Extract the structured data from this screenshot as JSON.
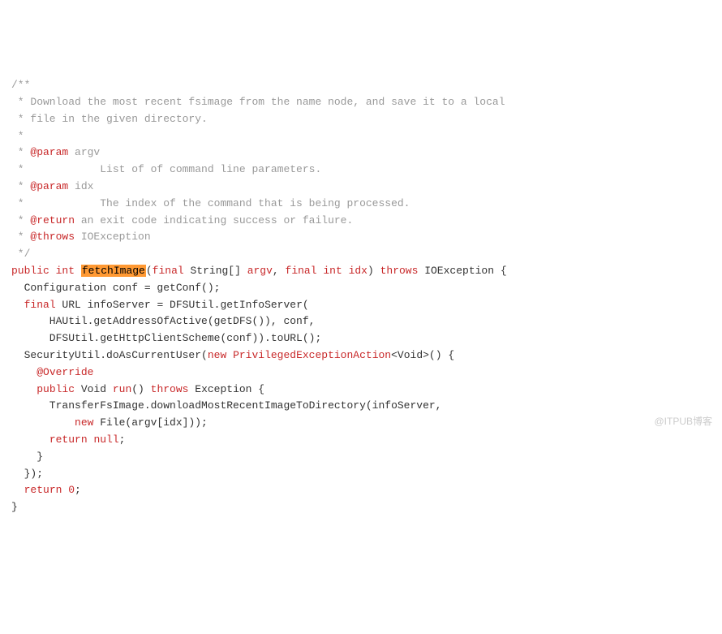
{
  "code": {
    "l1": "/**",
    "l2_a": " * Download the most recent fsimage from the name node, and save it to a local",
    "l3_a": " * file in the given directory.",
    "l4_a": " *",
    "l5_a": " * ",
    "l5_tag": "@param",
    "l5_b": " argv",
    "l6_a": " *            List of of command line parameters.",
    "l7_a": " * ",
    "l7_tag": "@param",
    "l7_b": " idx",
    "l8_a": " *            The index of the command that is being processed.",
    "l9_a": " * ",
    "l9_tag": "@return",
    "l9_b": " an exit code indicating success or failure.",
    "l10_a": " * ",
    "l10_tag": "@throws",
    "l10_b": " IOException",
    "l11_a": " */",
    "l12_kw1": "public",
    "l12_sp1": " ",
    "l12_kw2": "int",
    "l12_sp2": " ",
    "l12_method": "fetchImage",
    "l12_a": "(",
    "l12_kw3": "final",
    "l12_b": " String[] ",
    "l12_kw4": "argv",
    "l12_c": ", ",
    "l12_kw5": "final",
    "l12_sp3": " ",
    "l12_kw6": "int",
    "l12_sp4": " ",
    "l12_kw7": "idx",
    "l12_d": ") ",
    "l12_kw8": "throws",
    "l12_e": " IOException {",
    "l13_a": "  Configuration conf = getConf();",
    "l14_a": "  ",
    "l14_kw1": "final",
    "l14_b": " URL infoServer = DFSUtil.getInfoServer(",
    "l15_a": "      HAUtil.getAddressOfActive(getDFS()), conf,",
    "l16_a": "      DFSUtil.getHttpClientScheme(conf)).toURL();",
    "l17_a": "  SecurityUtil.doAsCurrentUser(",
    "l17_kw1": "new",
    "l17_b": " ",
    "l17_kw2": "PrivilegedExceptionAction",
    "l17_c": "<Void>() {",
    "l18_a": "    ",
    "l18_kw1": "@Override",
    "l19_a": "    ",
    "l19_kw1": "public",
    "l19_b": " Void ",
    "l19_kw2": "run",
    "l19_c": "() ",
    "l19_kw3": "throws",
    "l19_d": " Exception {",
    "l20_a": "      TransferFsImage.downloadMostRecentImageToDirectory(infoServer,",
    "l21_a": "          ",
    "l21_kw1": "new",
    "l21_b": " File(argv[idx]));",
    "l22_a": "      ",
    "l22_kw1": "return",
    "l22_sp": " ",
    "l22_kw2": "null",
    "l22_b": ";",
    "l23_a": "    }",
    "l24_a": "  });",
    "l25_a": "  ",
    "l25_kw1": "return",
    "l25_sp": " ",
    "l25_kw2": "0",
    "l25_b": ";",
    "l26_a": "}"
  },
  "watermark": "@ITPUB博客"
}
